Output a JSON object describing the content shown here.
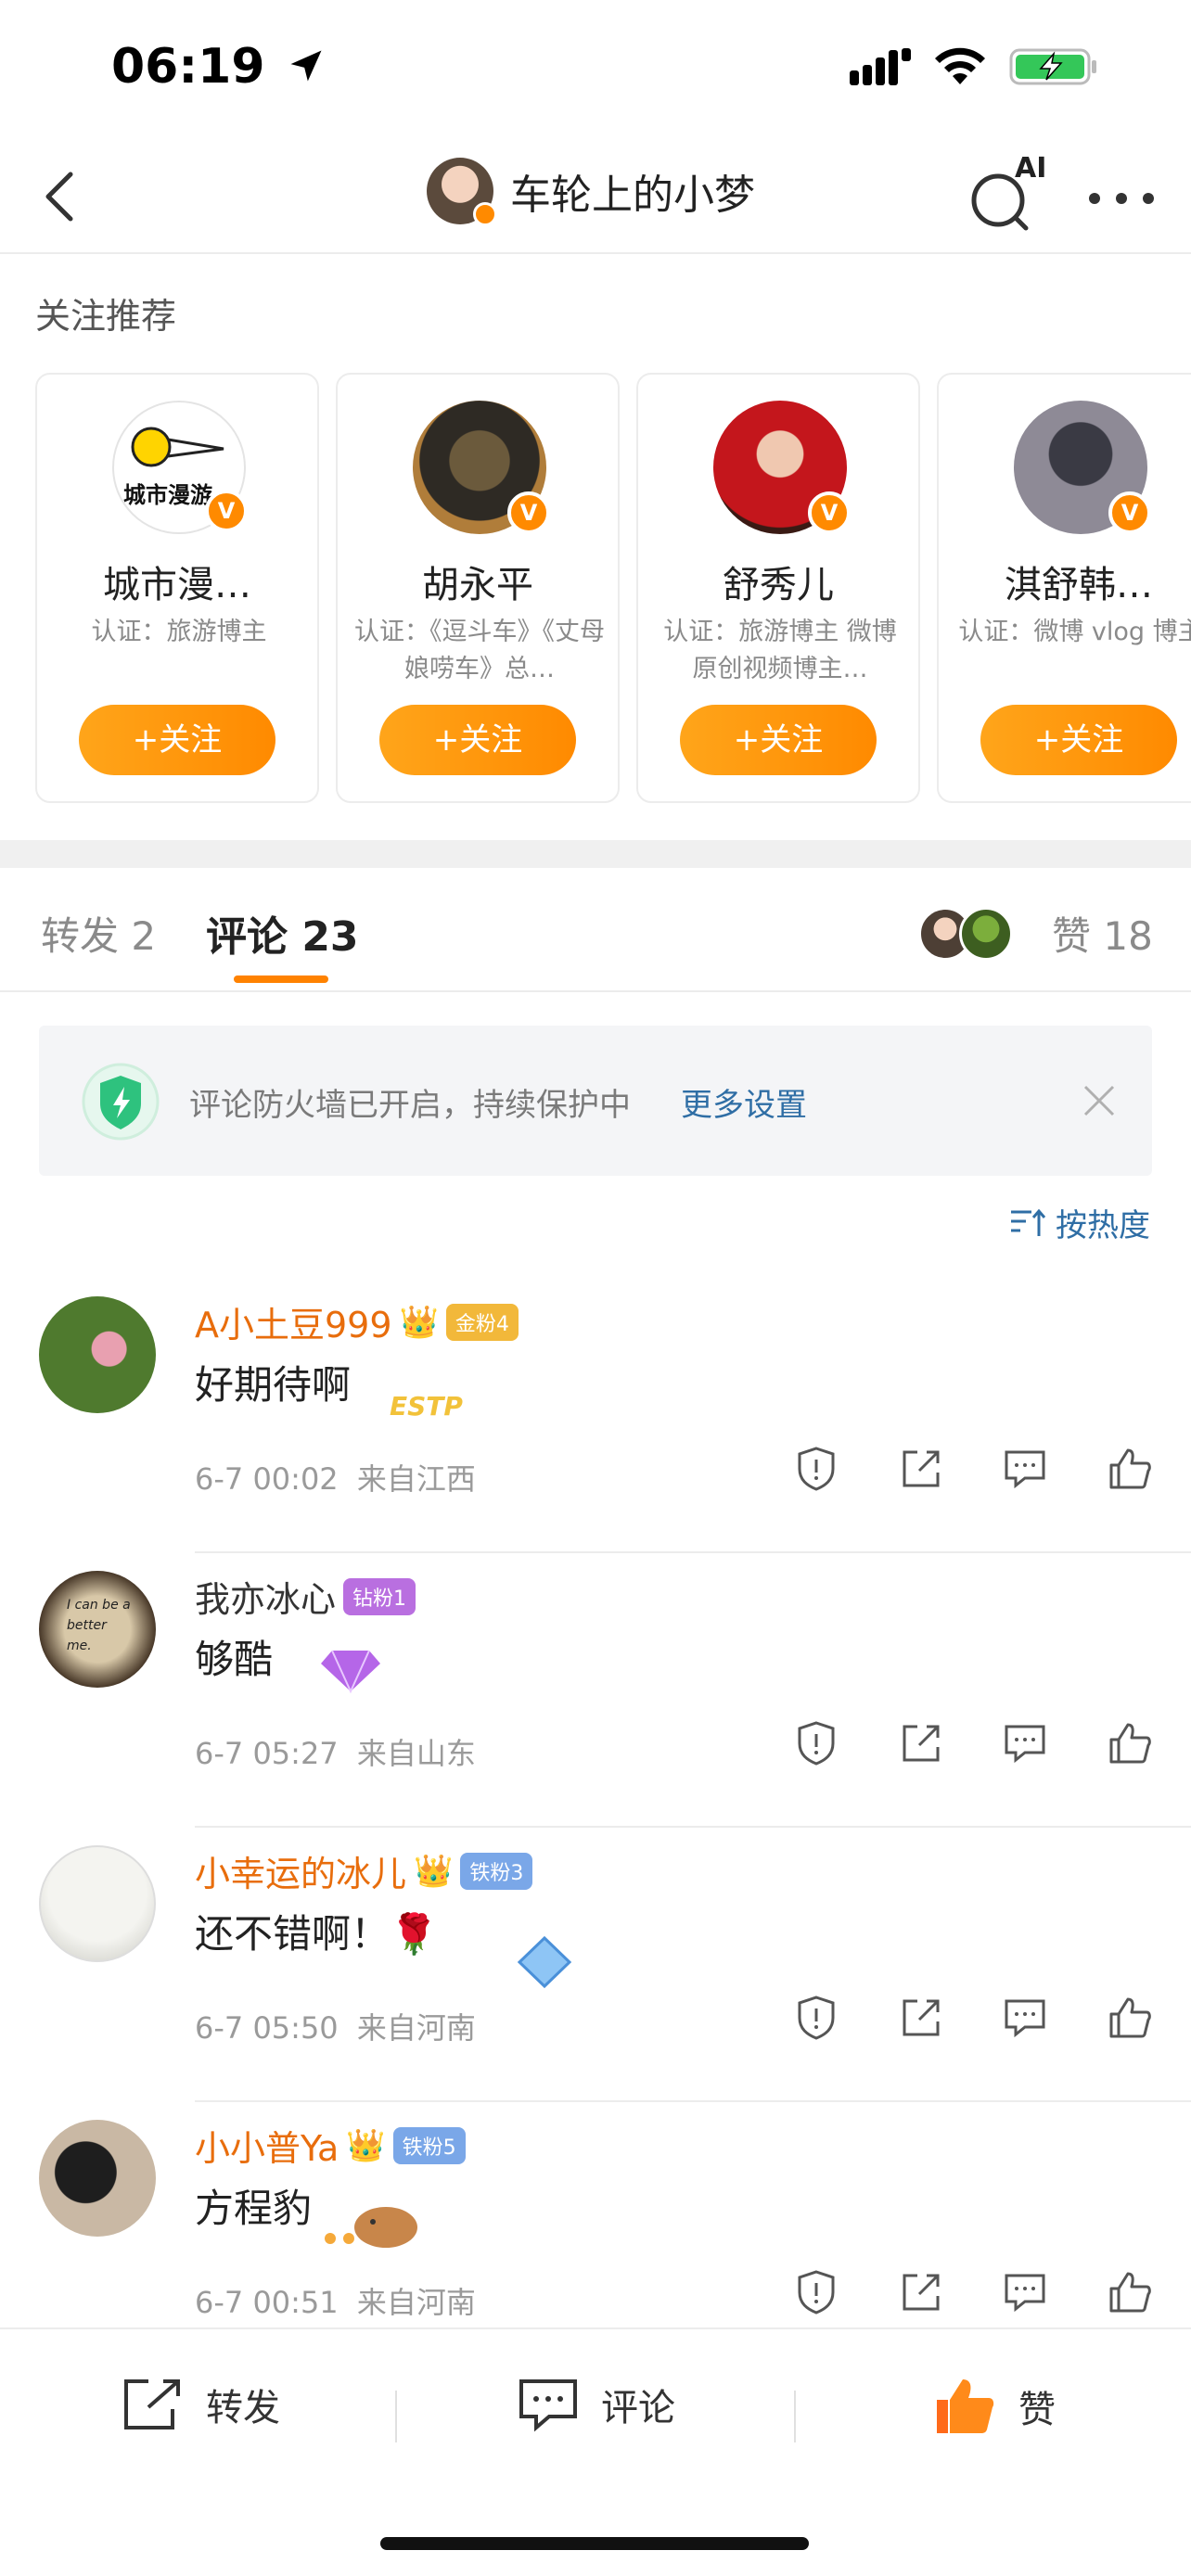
{
  "status_bar": {
    "time": "06:19"
  },
  "nav": {
    "title": "车轮上的小梦",
    "search_badge": "AI"
  },
  "recommend": {
    "heading": "关注推荐",
    "follow_label": "+关注",
    "cards": [
      {
        "name": "城市漫…",
        "desc": "认证：旅游博主",
        "avatar_text": "城市漫游"
      },
      {
        "name": "胡永平",
        "desc": "认证：《逗斗车》《丈母娘唠车》总…"
      },
      {
        "name": "舒秀儿",
        "desc": "认证：旅游博主 微博原创视频博主…"
      },
      {
        "name": "淇舒韩…",
        "desc": "认证：微博 vlog 博主"
      }
    ]
  },
  "tabs": {
    "repost": "转发 2",
    "comment": "评论 23",
    "likes": "赞 18"
  },
  "firewall": {
    "text": "评论防火墙已开启，持续保护中",
    "link": "更多设置"
  },
  "sort": {
    "label": "按热度"
  },
  "comments": [
    {
      "user": "A小土豆999",
      "fan_badge": "金粉4",
      "text": "好期待啊",
      "time": "6-7 00:02",
      "location": "来自江西",
      "deco_text": "ESTP"
    },
    {
      "user": "我亦冰心",
      "fan_badge": "钻粉1",
      "text": "够酷",
      "time": "6-7 05:27",
      "location": "来自山东",
      "avatar_text": "I can be a better me."
    },
    {
      "user": "小幸运的冰儿",
      "fan_badge": "铁粉3",
      "text": "还不错啊！🌹",
      "time": "6-7 05:50",
      "location": "来自河南"
    },
    {
      "user": "小小普Ya",
      "fan_badge": "铁粉5",
      "text": "方程豹",
      "time": "6-7 00:51",
      "location": "来自河南"
    }
  ],
  "bottom_bar": {
    "repost": "转发",
    "comment": "评论",
    "like": "赞"
  },
  "colors": {
    "accent": "#ff8200",
    "link": "#2f6ea5",
    "username": "#e86d0c"
  }
}
